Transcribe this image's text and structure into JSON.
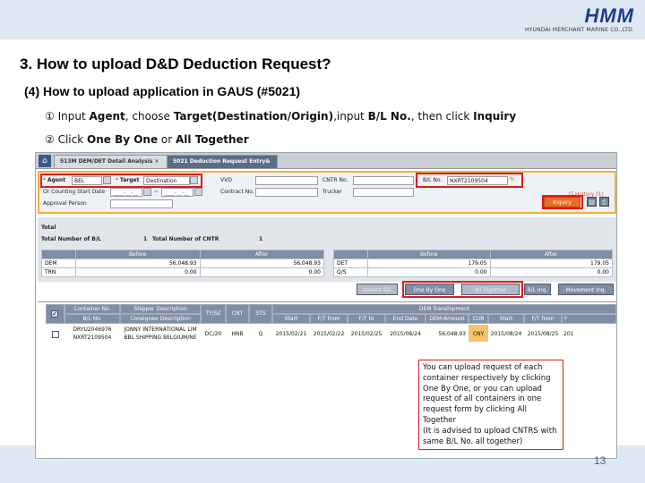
{
  "logo": {
    "mark": "HMM",
    "sub": "HYUNDAI MERCHANT MARINE CO.,LTD."
  },
  "title": "3. How to upload D&D Deduction Request?",
  "subtitle": "(4) How to upload application in GAUS (#5021)",
  "step1": {
    "num": "①",
    "pre": "Input ",
    "agent": "Agent",
    "mid1": ", choose ",
    "target": "Target(Destination/Origin)",
    "mid2": ",input ",
    "bl": "B/L No.",
    "mid3": ", then click ",
    "inquiry": "Inquiry"
  },
  "step2": {
    "num": "②",
    "pre": "Click ",
    "one": "One By One",
    "mid": " or ",
    "all": "All Together"
  },
  "tabs": [
    {
      "label": "513M DEM/DET Detail Analysis"
    },
    {
      "label": "5021 Deduction Request Entry&"
    }
  ],
  "form": {
    "agent_label": "Agent",
    "agent_value": "BEL",
    "target_label": "Target",
    "target_value": "Destination",
    "vvd_label": "VVD",
    "cntr_label": "CNTR No.",
    "bl_label": "B/L No.",
    "bl_value": "NXRT2109504",
    "start_label": "Or Counting Start Date",
    "date_from": "____-__-__",
    "date_sep": "~",
    "date_to": "____-__-__",
    "contract_label": "Contract No.",
    "trucker_label": "Trucker",
    "approval_label": "Approval Person",
    "history": "IT-History (1)",
    "inquiry": "Inquiry"
  },
  "total": {
    "title": "Total",
    "bl_label": "Total Number of B/L",
    "bl_value": "1",
    "cntr_label": "Total Number of CNTR",
    "cntr_value": "1",
    "head_before": "Before",
    "head_after": "After",
    "rows": [
      {
        "name": "DEM",
        "before": "56,048.93",
        "after": "56,048.93",
        "name2": "DET",
        "before2": "179.05",
        "after2": "179.05"
      },
      {
        "name": "TRN",
        "before": "0.00",
        "after": "0.00",
        "name2": "Q/S",
        "before2": "0.00",
        "after2": "0.00"
      }
    ]
  },
  "buttons": {
    "unlimit": "Unlimit B/L",
    "one": "One By One",
    "all": "All Together",
    "bl_inq": "B/L Inq.",
    "movement": "Movement Inq."
  },
  "grid": {
    "h_container": "Container No.",
    "h_bl": "B/L No.",
    "h_shipper": "Shipper Description",
    "h_consignee": "Consignee Description",
    "h_tysz": "TY/SZ",
    "h_cnt": "CNT",
    "h_sts": "STS",
    "h_dem": "DEM Transhipment",
    "h_start": "Start",
    "h_ftto": "F/T from",
    "h_ftto2": "F/T to",
    "h_end": "End Date",
    "h_amount": "DEM-Amount",
    "h_cur": "CUR",
    "h_start2": "Start",
    "h_ftfrom": "F/T from",
    "h_ft3": "F",
    "row": {
      "cntr": "DRYU2046976",
      "bl": "NXRT2109504",
      "shipper": "JONNY INTERNATIONAL LIM",
      "consignee": "BBL SHIPPING BELGIUM/NE",
      "tysz": "DC/20",
      "cnt": "HNB",
      "sts": "Q",
      "start": "2015/02/21",
      "ftfrom": "2015/02/22",
      "ftto": "2015/02/25",
      "end": "2015/08/24",
      "amount": "56,048.93",
      "cur": "CNY",
      "start2": "2015/08/24",
      "ftfrom2": "2015/08/25",
      "f3": "201"
    }
  },
  "note": "You can upload request of each container respectively by clicking One By One, or you can upload request of all containers in one request form by clicking All Together\n(It is advised to upload CNTRS with same B/L No. all together)",
  "page_number": "13"
}
